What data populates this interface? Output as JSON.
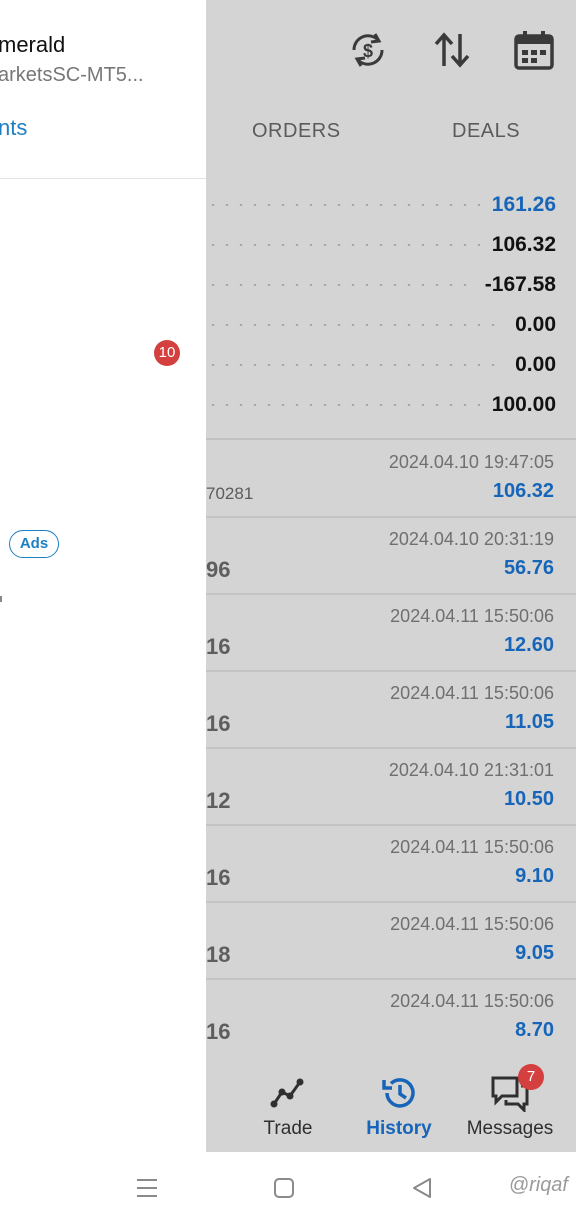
{
  "toolbar": {
    "icons": [
      "currency-exchange-icon",
      "sort-icon",
      "calendar-icon"
    ]
  },
  "tabs": {
    "orders": "ORDERS",
    "deals": "DEALS"
  },
  "summary": [
    {
      "value": "161.26",
      "color": "#1765b8"
    },
    {
      "value": "106.32",
      "color": "#111111"
    },
    {
      "value": "-167.58",
      "color": "#111111"
    },
    {
      "value": "0.00",
      "color": "#111111"
    },
    {
      "value": "0.00",
      "color": "#111111"
    },
    {
      "value": "100.00",
      "color": "#111111"
    }
  ],
  "deals": [
    {
      "left": "70281",
      "time": "2024.04.10 19:47:05",
      "profit": "106.32"
    },
    {
      "left": "96",
      "time": "2024.04.10 20:31:19",
      "profit": "56.76"
    },
    {
      "left": "16",
      "time": "2024.04.11 15:50:06",
      "profit": "12.60"
    },
    {
      "left": "16",
      "time": "2024.04.11 15:50:06",
      "profit": "11.05"
    },
    {
      "left": "12",
      "time": "2024.04.10 21:31:01",
      "profit": "10.50"
    },
    {
      "left": "16",
      "time": "2024.04.11 15:50:06",
      "profit": "9.10"
    },
    {
      "left": "18",
      "time": "2024.04.11 15:50:06",
      "profit": "9.05"
    },
    {
      "left": "16",
      "time": "2024.04.11 15:50:06",
      "profit": "8.70"
    }
  ],
  "bottom_nav": {
    "trade": "Trade",
    "history": "History",
    "messages": "Messages",
    "messages_badge": "7"
  },
  "drawer": {
    "account_name": "merald",
    "server": "arketsSC-MT5...",
    "link": "nts",
    "badge_count": "10",
    "ads_label": "Ads"
  },
  "colors": {
    "accent": "#1765b8",
    "link": "#1e7fc2",
    "badge": "#d4403f",
    "overlay": "#d4d4d4"
  },
  "watermark": "@riqaf"
}
